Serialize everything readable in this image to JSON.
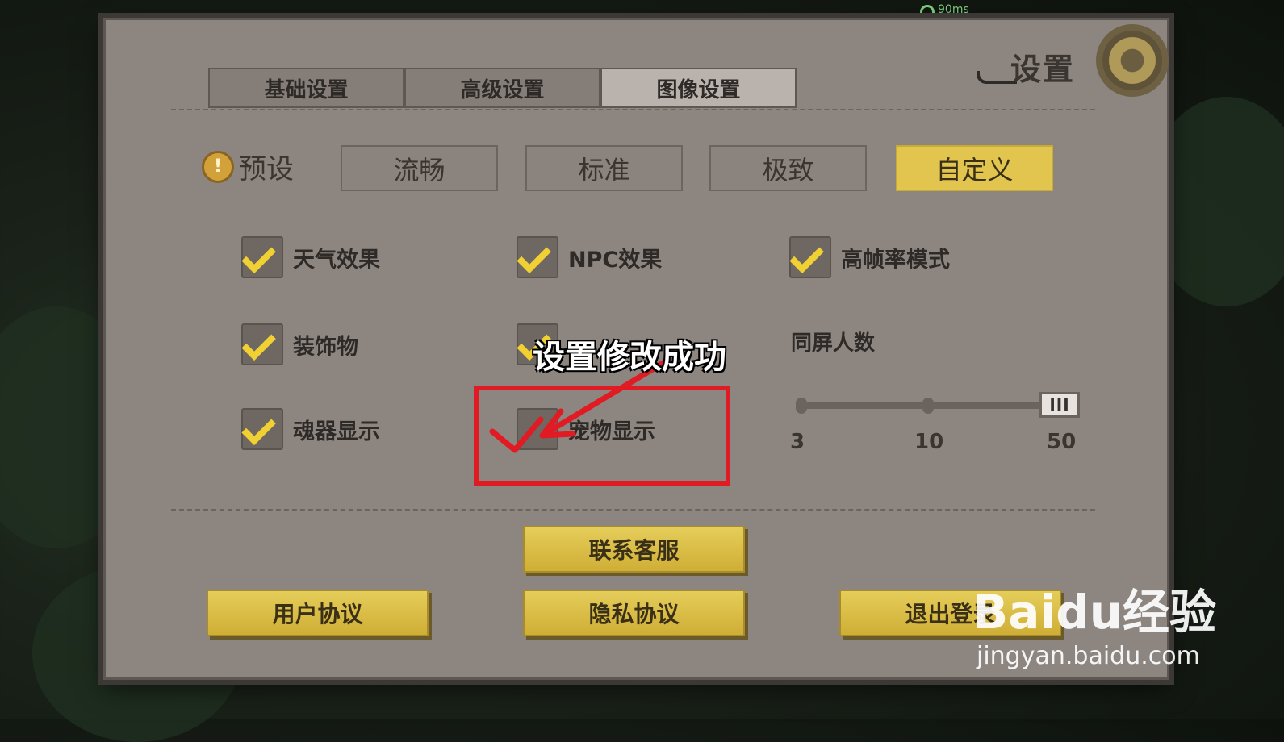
{
  "status": {
    "latency": "90ms"
  },
  "panel": {
    "title": "设置",
    "title_icon": "gear-icon"
  },
  "tabs": [
    {
      "label": "基础设置",
      "active": false
    },
    {
      "label": "高级设置",
      "active": false
    },
    {
      "label": "图像设置",
      "active": true
    }
  ],
  "preset": {
    "label": "预设",
    "options": [
      {
        "label": "流畅",
        "selected": false
      },
      {
        "label": "标准",
        "selected": false
      },
      {
        "label": "极致",
        "selected": false
      },
      {
        "label": "自定义",
        "selected": true
      }
    ]
  },
  "options": [
    {
      "label": "天气效果",
      "checked": true
    },
    {
      "label": "NPC效果",
      "checked": true
    },
    {
      "label": "高帧率模式",
      "checked": true
    },
    {
      "label": "装饰物",
      "checked": true
    },
    {
      "label": "",
      "checked": true
    },
    {
      "label": "魂器显示",
      "checked": true
    },
    {
      "label": "宠物显示",
      "checked": false
    }
  ],
  "screen_count": {
    "label": "同屏人数",
    "ticks": [
      "3",
      "10",
      "50"
    ],
    "selected": "50",
    "handle_label": "III"
  },
  "toast": "设置修改成功",
  "buttons": {
    "contact": "联系客服",
    "user_agreement": "用户协议",
    "privacy": "隐私协议",
    "logout": "退出登录"
  },
  "watermark": {
    "main": "Baidu经验",
    "sub": "jingyan.baidu.com"
  },
  "colors": {
    "accent": "#e1c54e",
    "highlight_red": "#e01b23",
    "panel": "#8d8680"
  }
}
